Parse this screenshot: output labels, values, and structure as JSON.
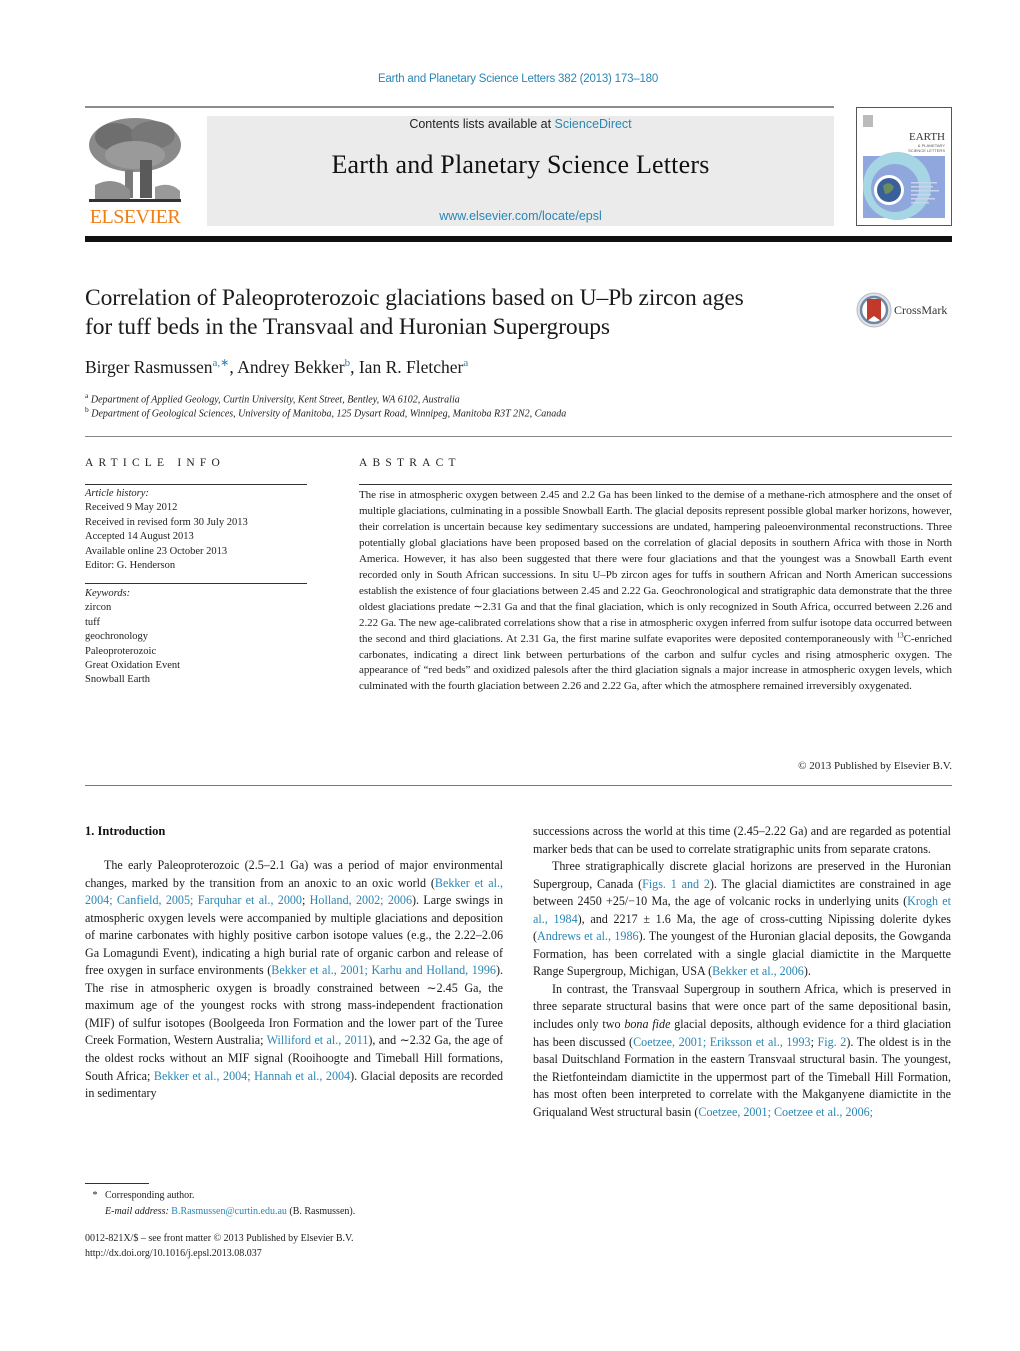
{
  "running_head": "Earth and Planetary Science Letters 382 (2013) 173–180",
  "masthead": {
    "publisher_logo_word": "ELSEVIER",
    "contents_prefix": "Contents lists available at ",
    "contents_link": "ScienceDirect",
    "journal_name": "Earth and Planetary Science Letters",
    "journal_url": "www.elsevier.com/locate/epsl",
    "cover_title": "EARTH",
    "cover_subtitle": "PLANETARY SCIENCE LETTERS"
  },
  "article": {
    "title_line1": "Correlation of Paleoproterozoic glaciations based on U–Pb zircon ages",
    "title_line2": "for tuff beds in the Transvaal and Huronian Supergroups",
    "crossmark_label": "CrossMark",
    "authors": [
      {
        "name": "Birger Rasmussen",
        "sup": "a,∗",
        "sep": ", "
      },
      {
        "name": "Andrey Bekker",
        "sup": "b",
        "sep": ", "
      },
      {
        "name": "Ian R. Fletcher",
        "sup": "a",
        "sep": ""
      }
    ],
    "affiliations": [
      {
        "mark": "a",
        "text": "Department of Applied Geology, Curtin University, Kent Street, Bentley, WA 6102, Australia"
      },
      {
        "mark": "b",
        "text": "Department of Geological Sciences, University of Manitoba, 125 Dysart Road, Winnipeg, Manitoba R3T 2N2, Canada"
      }
    ]
  },
  "article_info": {
    "label": "ARTICLE INFO",
    "history_heading": "Article history:",
    "history": [
      "Received 9 May 2012",
      "Received in revised form 30 July 2013",
      "Accepted 14 August 2013",
      "Available online 23 October 2013",
      "Editor: G. Henderson"
    ],
    "keywords_heading": "Keywords:",
    "keywords": [
      "zircon",
      "tuff",
      "geochronology",
      "Paleoproterozoic",
      "Great Oxidation Event",
      "Snowball Earth"
    ]
  },
  "abstract": {
    "label": "ABSTRACT",
    "text_part1": "The rise in atmospheric oxygen between 2.45 and 2.2 Ga has been linked to the demise of a methane-rich atmosphere and the onset of multiple glaciations, culminating in a possible Snowball Earth. The glacial deposits represent possible global marker horizons, however, their correlation is uncertain because key sedimentary successions are undated, hampering paleoenvironmental reconstructions. Three potentially global glaciations have been proposed based on the correlation of glacial deposits in southern Africa with those in North America. However, it has also been suggested that there were four glaciations and that the youngest was a Snowball Earth event recorded only in South African successions. In situ U–Pb zircon ages for tuffs in southern African and North American successions establish the existence of four glaciations between 2.45 and 2.22 Ga. Geochronological and stratigraphic data demonstrate that the three oldest glaciations predate ∼2.31 Ga and that the final glaciation, which is only recognized in South Africa, occurred between 2.26 and 2.22 Ga. The new age-calibrated correlations show that a rise in atmospheric oxygen inferred from sulfur isotope data occurred between the second and third glaciations. At 2.31 Ga, the first marine sulfate evaporites were deposited contemporaneously with ",
    "isotope_sup": "13",
    "text_part2": "C-enriched carbonates, indicating a direct link between perturbations of the carbon and sulfur cycles and rising atmospheric oxygen. The appearance of “red beds” and oxidized palesols after the third glaciation signals a major increase in atmospheric oxygen levels, which culminated with the fourth glaciation between 2.26 and 2.22 Ga, after which the atmosphere remained irreversibly oxygenated.",
    "copyright": "© 2013 Published by Elsevier B.V."
  },
  "body": {
    "section_heading": "1. Introduction",
    "left_col": [
      {
        "t": "The early Paleoproterozoic (2.5–2.1 Ga) was a period of ma­jor environmental changes, marked by the transition from an anoxic to an oxic world ("
      },
      {
        "link": "Bekker et al., 2004; Canfield, 2005; Farquhar et al., 2000"
      },
      {
        "t": "; "
      },
      {
        "link": "Holland, 2002; 2006"
      },
      {
        "t": "). Large swings in atmo­spheric oxygen levels were accompanied by multiple glaciations and deposition of marine carbonates with highly positive carbon isotope values (e.g., the 2.22–2.06 Ga Lomagundi Event), indicat­ing a high burial rate of organic carbon and release of free oxygen in surface environments ("
      },
      {
        "link": "Bekker et al., 2001; Karhu and Holland, 1996"
      },
      {
        "t": "). The rise in atmospheric oxygen is broadly constrained be­tween ∼2.45 Ga, the maximum age of the youngest rocks with strong mass-independent fractionation (MIF) of sulfur isotopes (Boolgeeda Iron Formation and the lower part of the Turee Creek Formation, Western Australia; "
      },
      {
        "link": "Williford et al., 2011"
      },
      {
        "t": "), and ∼2.32 Ga, the age of the oldest rocks without an MIF signal (Rooihoogte and Timeball Hill formations, South Africa; "
      },
      {
        "link": "Bekker et al., 2004; Hannah et al., 2004"
      },
      {
        "t": "). Glacial deposits are recorded in sedimentary"
      }
    ],
    "right_col_p1": [
      {
        "t": "successions across the world at this time (2.45–2.22 Ga) and are regarded as potential marker beds that can be used to correlate stratigraphic units from separate cratons."
      }
    ],
    "right_col_p2": [
      {
        "t": "Three stratigraphically discrete glacial horizons are preserved in the Huronian Supergroup, Canada ("
      },
      {
        "link": "Figs. 1 and 2"
      },
      {
        "t": "). The glacial di­amictites are constrained in age between 2450 +25/−10 Ma, the age of volcanic rocks in underlying units ("
      },
      {
        "link": "Krogh et al., 1984"
      },
      {
        "t": "), and 2217 ± 1.6 Ma, the age of cross-cutting Nipissing dolerite dykes ("
      },
      {
        "link": "Andrews et al., 1986"
      },
      {
        "t": "). The youngest of the Huronian glacial de­posits, the Gowganda Formation, has been correlated with a single glacial diamictite in the Marquette Range Supergroup, Michigan, USA ("
      },
      {
        "link": "Bekker et al., 2006"
      },
      {
        "t": ")."
      }
    ],
    "right_col_p3": [
      {
        "t": "In contrast, the Transvaal Supergroup in southern Africa, which is preserved in three separate structural basins that were once part of the same depositional basin, includes only two "
      },
      {
        "i": "bona fide"
      },
      {
        "t": " glacial deposits, although evidence for a third glaciation has been dis­cussed ("
      },
      {
        "link": "Coetzee, 2001; Eriksson et al., 1993"
      },
      {
        "t": "; "
      },
      {
        "link": "Fig. 2"
      },
      {
        "t": "). The oldest is in the basal Duitschland Formation in the eastern Transvaal structural basin. The youngest, the Rietfonteindam diamictite in the upper­most part of the Timeball Hill Formation, has most often been interpreted to correlate with the Makganyene diamictite in the Gri­qualand West structural basin ("
      },
      {
        "link": "Coetzee, 2001; Coetzee et al., 2006;"
      }
    ]
  },
  "footnotes": {
    "corresponding_mark": "*",
    "corresponding_text": "Corresponding author.",
    "email_label": "E-mail address:",
    "email": "B.Rasmussen@curtin.edu.au",
    "email_suffix": " (B. Rasmussen).",
    "front_matter": "0012-821X/$ – see front matter  © 2013 Published by Elsevier B.V.",
    "doi": "http://dx.doi.org/10.1016/j.epsl.2013.08.037"
  },
  "colors": {
    "link": "#2a86b5",
    "elsevier_orange": "#f07f16",
    "masthead_bg": "#ebebeb",
    "crossmark_red": "#c0392b"
  }
}
